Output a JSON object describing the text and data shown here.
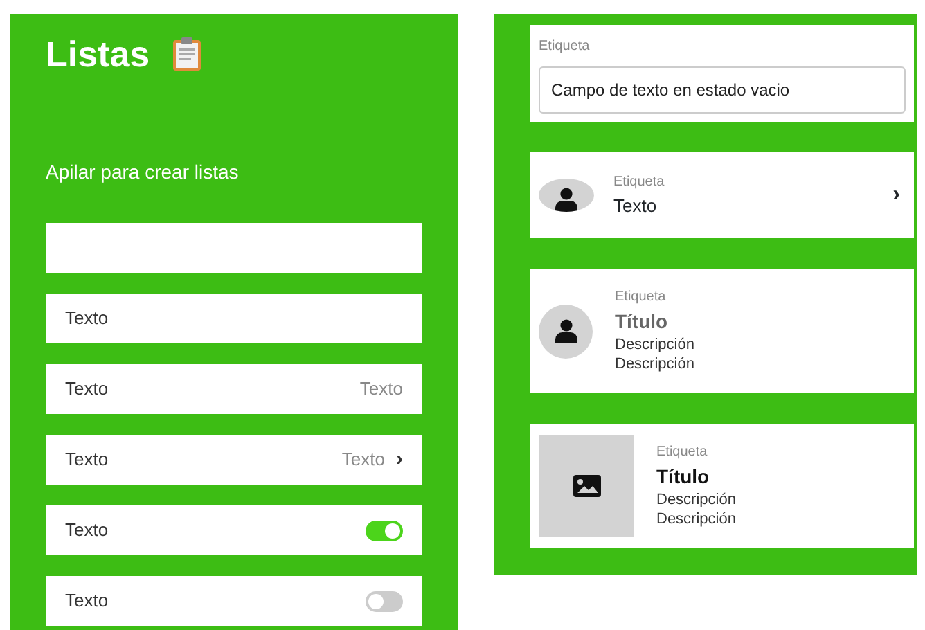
{
  "left_panel": {
    "title": "Listas",
    "subtitle": "Apilar para crear listas",
    "rows": [
      {
        "kind": "empty"
      },
      {
        "kind": "text",
        "label": "Texto"
      },
      {
        "kind": "value",
        "label": "Texto",
        "value": "Texto"
      },
      {
        "kind": "value_chevron",
        "label": "Texto",
        "value": "Texto",
        "chevron": "›"
      },
      {
        "kind": "switch",
        "label": "Texto",
        "on": true
      },
      {
        "kind": "switch",
        "label": "Texto",
        "on": false
      }
    ]
  },
  "right_panel": {
    "cards": [
      {
        "kind": "field",
        "label": "Etiqueta",
        "value": "Campo de texto en estado vacio"
      },
      {
        "kind": "avatar_item",
        "label": "Etiqueta",
        "text": "Texto",
        "chevron": "›"
      },
      {
        "kind": "avatar_detail",
        "label": "Etiqueta",
        "title": "Título",
        "descriptions": [
          "Descripción",
          "Descripción"
        ]
      },
      {
        "kind": "image_detail",
        "label": "Etiqueta",
        "title": "Título",
        "descriptions": [
          "Descripción",
          "Descripción"
        ]
      }
    ]
  }
}
